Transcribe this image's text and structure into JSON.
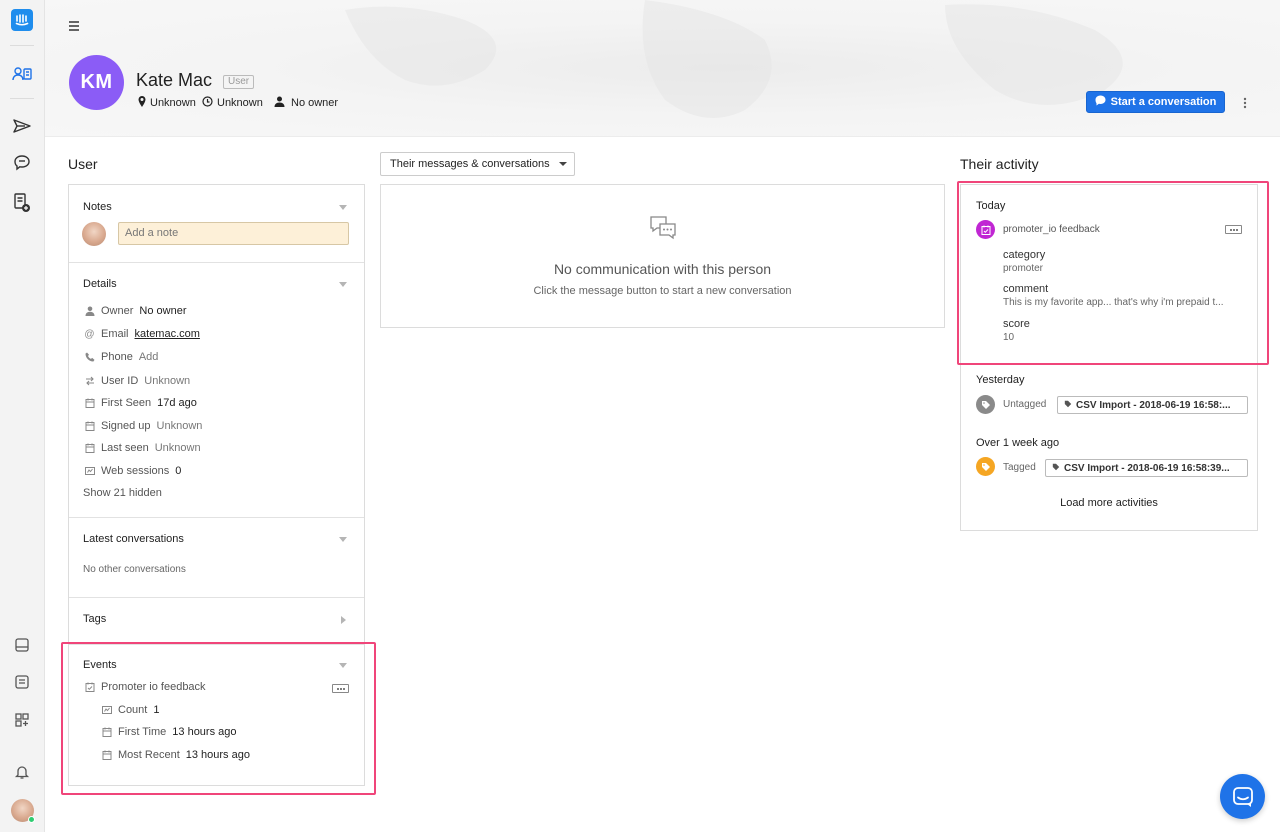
{
  "profile": {
    "initials": "KM",
    "name": "Kate Mac",
    "badge": "User",
    "location": "Unknown",
    "timezone": "Unknown",
    "owner": "No owner",
    "avatar_color": "#8b5cf6"
  },
  "header": {
    "start_button": "Start a conversation",
    "accent": "#1f73e8"
  },
  "left": {
    "title": "User",
    "notes": {
      "title": "Notes",
      "placeholder": "Add a note"
    },
    "details": {
      "title": "Details",
      "rows": [
        {
          "icon": "person-icon",
          "label": "Owner",
          "value": "No owner"
        },
        {
          "icon": "at-icon",
          "label": "Email",
          "value": "katemac.com"
        },
        {
          "icon": "phone-icon",
          "label": "Phone",
          "value": "Add"
        },
        {
          "icon": "swap-icon",
          "label": "User ID",
          "value": "Unknown"
        },
        {
          "icon": "calendar-icon",
          "label": "First Seen",
          "value": "17d ago"
        },
        {
          "icon": "calendar-icon",
          "label": "Signed up",
          "value": "Unknown"
        },
        {
          "icon": "calendar-icon",
          "label": "Last seen",
          "value": "Unknown"
        },
        {
          "icon": "counter-icon",
          "label": "Web sessions",
          "value": "0"
        }
      ],
      "show_hidden": "Show 21 hidden"
    },
    "conversations": {
      "title": "Latest conversations",
      "empty": "No other conversations"
    },
    "tags": {
      "title": "Tags"
    },
    "events": {
      "title": "Events",
      "event_name": "Promoter io feedback",
      "rows": [
        {
          "icon": "counter-icon",
          "label": "Count",
          "value": "1"
        },
        {
          "icon": "calendar-icon",
          "label": "First Time",
          "value": "13 hours ago"
        },
        {
          "icon": "calendar-icon",
          "label": "Most Recent",
          "value": "13 hours ago"
        }
      ]
    }
  },
  "middle": {
    "dropdown": "Their messages & conversations",
    "empty_title": "No communication with this person",
    "empty_sub": "Click the message button to start a new conversation"
  },
  "activity": {
    "title": "Their activity",
    "today": {
      "heading": "Today",
      "event": "promoter_io feedback",
      "icon_color": "#c026d3",
      "fields": [
        {
          "key": "category",
          "value": "promoter"
        },
        {
          "key": "comment",
          "value": "This is my favorite app... that's why i'm prepaid t..."
        },
        {
          "key": "score",
          "value": "10"
        }
      ]
    },
    "yesterday": {
      "heading": "Yesterday",
      "action": "Untagged",
      "tag": "CSV Import - 2018-06-19 16:58:...",
      "icon_color": "#8a8a8a"
    },
    "older": {
      "heading": "Over 1 week ago",
      "action": "Tagged",
      "tag": "CSV Import - 2018-06-19 16:58:39...",
      "icon_color": "#f5a623"
    },
    "load_more": "Load more activities"
  }
}
